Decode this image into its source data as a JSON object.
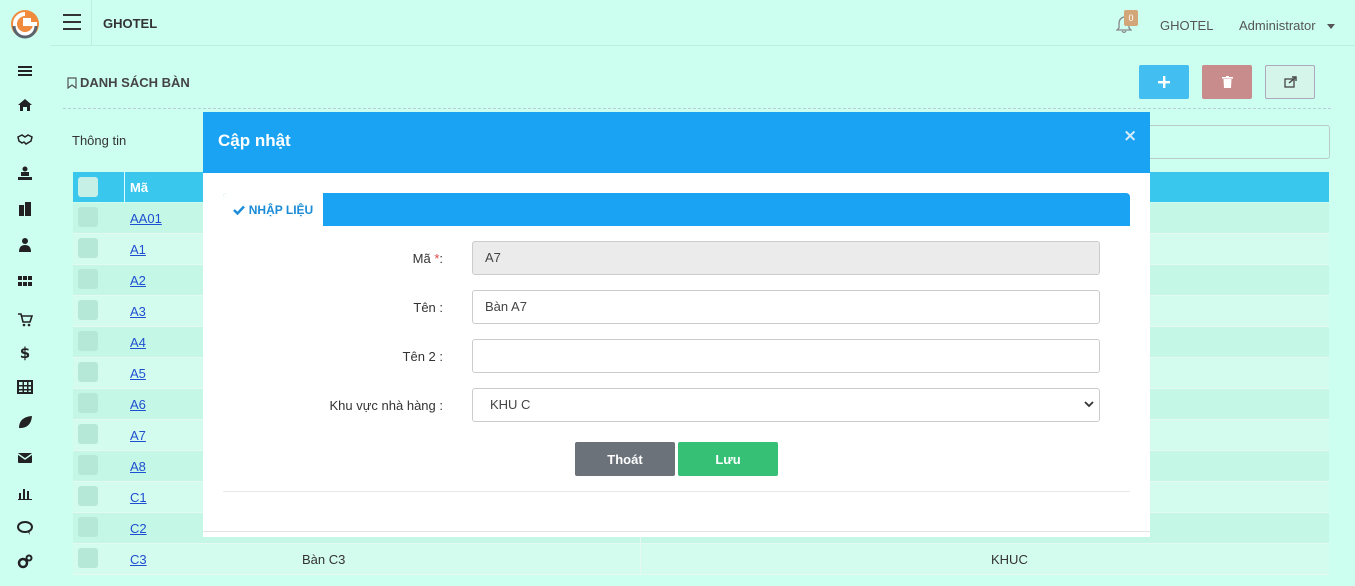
{
  "app": {
    "brand": "GHOTEL",
    "notification_count": "0",
    "user_name": "GHOTEL",
    "user_role": "Administrator"
  },
  "sidebar": {
    "icons": [
      "menu-icon",
      "home-icon",
      "handshake-icon",
      "reception-icon",
      "building-icon",
      "users-icon",
      "grid-icon",
      "cart-icon",
      "dollar-icon",
      "table-icon",
      "leaf-icon",
      "mail-icon",
      "chart-icon",
      "chat-icon",
      "gears-icon"
    ],
    "dollar_glyph": "$"
  },
  "page": {
    "title": "DANH SÁCH BÀN",
    "info_label": "Thông tin"
  },
  "table": {
    "col_code": "Mã",
    "rows": [
      {
        "code": "AA01",
        "name": "",
        "area": ""
      },
      {
        "code": "A1",
        "name": "",
        "area": ""
      },
      {
        "code": "A2",
        "name": "",
        "area": ""
      },
      {
        "code": "A3",
        "name": "",
        "area": ""
      },
      {
        "code": "A4",
        "name": "",
        "area": ""
      },
      {
        "code": "A5",
        "name": "",
        "area": ""
      },
      {
        "code": "A6",
        "name": "",
        "area": ""
      },
      {
        "code": "A7",
        "name": "",
        "area": ""
      },
      {
        "code": "A8",
        "name": "",
        "area": ""
      },
      {
        "code": "C1",
        "name": "",
        "area": ""
      },
      {
        "code": "C2",
        "name": "",
        "area": ""
      },
      {
        "code": "C3",
        "name": "Bàn C3",
        "area": "KHUC"
      }
    ]
  },
  "modal": {
    "title": "Cập nhật",
    "close": "×",
    "tab_label": "NHẬP LIỆU",
    "fields": {
      "code_label": "Mã",
      "code_required": "*",
      "code_colon": ":",
      "code_value": "A7",
      "name_label": "Tên :",
      "name_value": "Bàn A7",
      "name2_label": "Tên 2 :",
      "name2_value": "",
      "area_label": "Khu vực nhà hàng :",
      "area_value": "KHU C"
    },
    "exit_button": "Thoát",
    "save_button": "Lưu"
  },
  "colors": {
    "background": "#ccfff0",
    "accent_blue": "#1aa3f2",
    "table_header": "#3ac7ee",
    "save_green": "#35c076",
    "exit_gray": "#6c727a",
    "delete_red": "#c98c8c"
  }
}
